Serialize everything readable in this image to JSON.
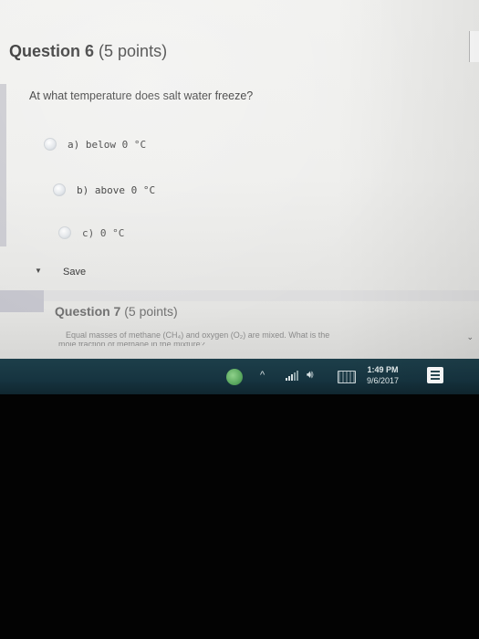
{
  "question6": {
    "number_label": "Question 6",
    "points_label": "(5 points)",
    "prompt": "At what temperature does salt water freeze?",
    "options": [
      {
        "letter": "a)",
        "text": "below 0 °C"
      },
      {
        "letter": "b)",
        "text": "above 0 °C"
      },
      {
        "letter": "c)",
        "text": "0 °C"
      }
    ],
    "save_label": "Save"
  },
  "question7": {
    "number_label": "Question 7",
    "points_label": "(5 points)",
    "prompt_line1": "Equal masses of methane (CH₄) and oxygen (O₂) are mixed. What is the",
    "prompt_line2": "mole fraction of methane in the mixture?"
  },
  "taskbar": {
    "time": "1:49 PM",
    "date": "9/6/2017"
  },
  "icons": {
    "radio": "radio-button-icon",
    "cortana": "cortana-icon",
    "tray_chevron": "chevron-up-icon",
    "network": "network-icon",
    "volume": "volume-icon",
    "keyboard": "keyboard-icon",
    "notification": "notification-icon"
  }
}
